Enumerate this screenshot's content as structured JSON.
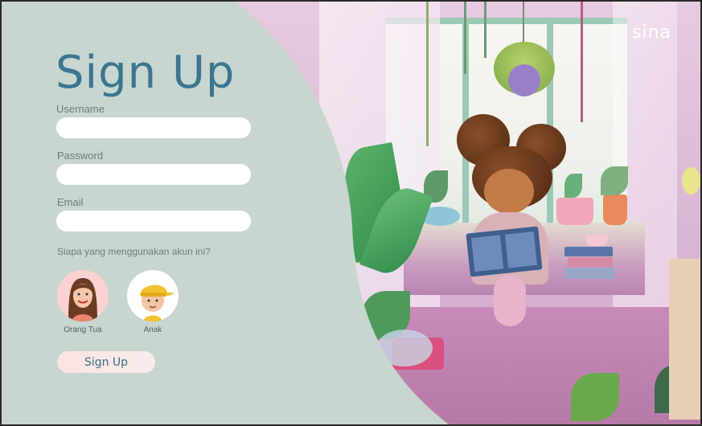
{
  "brand": {
    "name": "sina"
  },
  "form": {
    "title": "Sign Up",
    "username": {
      "label": "Username",
      "value": "",
      "placeholder": ""
    },
    "password": {
      "label": "Password",
      "value": "",
      "placeholder": ""
    },
    "email": {
      "label": "Email",
      "value": "",
      "placeholder": ""
    },
    "question": "Siapa yang menggunakan akun ini?",
    "roles": [
      {
        "label": "Orang Tua",
        "icon": "woman-avatar-icon"
      },
      {
        "label": "Anak",
        "icon": "boy-avatar-icon"
      }
    ],
    "submit_label": "Sign Up"
  },
  "colors": {
    "panel": "#c7d6cf",
    "title": "#3b7690",
    "button_text": "#3b6f86"
  }
}
